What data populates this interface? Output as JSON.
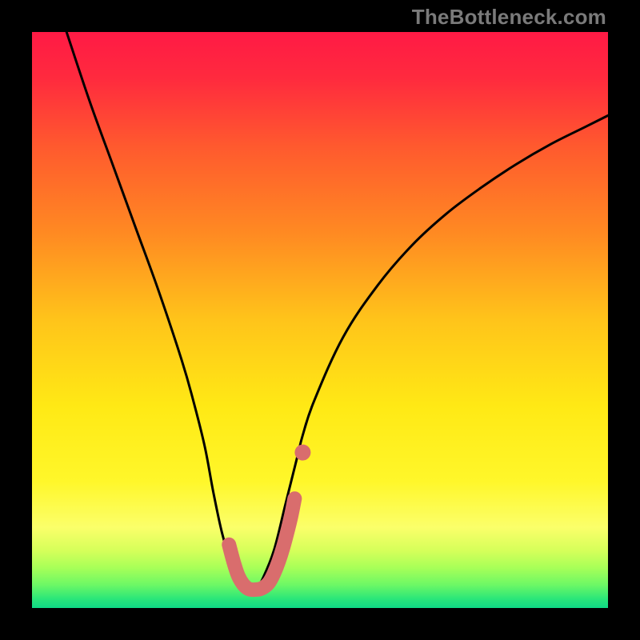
{
  "watermark": "TheBottleneck.com",
  "colors": {
    "frame": "#000000",
    "gradient_stops": [
      {
        "offset": 0.0,
        "color": "#ff1a45"
      },
      {
        "offset": 0.08,
        "color": "#ff2a3e"
      },
      {
        "offset": 0.2,
        "color": "#ff5a2e"
      },
      {
        "offset": 0.35,
        "color": "#ff8a22"
      },
      {
        "offset": 0.5,
        "color": "#ffc41a"
      },
      {
        "offset": 0.65,
        "color": "#ffe915"
      },
      {
        "offset": 0.78,
        "color": "#fff72a"
      },
      {
        "offset": 0.86,
        "color": "#fbff6a"
      },
      {
        "offset": 0.9,
        "color": "#d6ff5a"
      },
      {
        "offset": 0.93,
        "color": "#a8ff58"
      },
      {
        "offset": 0.96,
        "color": "#6cf865"
      },
      {
        "offset": 0.985,
        "color": "#28e57a"
      },
      {
        "offset": 1.0,
        "color": "#0fd985"
      }
    ],
    "curve_stroke": "#000000",
    "basin_stroke": "#d96d6d",
    "basin_dot": "#d96d6d"
  },
  "chart_data": {
    "type": "line",
    "title": "",
    "xlabel": "",
    "ylabel": "",
    "xlim": [
      0,
      100
    ],
    "ylim": [
      0,
      100
    ],
    "series": [
      {
        "name": "bottleneck-curve",
        "x": [
          6,
          10,
          14,
          18,
          22,
          26,
          28,
          30,
          31.5,
          33,
          34.5,
          36,
          37,
          37.6,
          38.2,
          39,
          40,
          42,
          44,
          46,
          47,
          49,
          54,
          60,
          66,
          72,
          78,
          84,
          90,
          96,
          100
        ],
        "y": [
          100,
          88,
          77,
          66,
          55,
          43,
          36,
          28,
          20,
          13,
          8,
          4.5,
          3.5,
          3.2,
          3.2,
          3.5,
          5,
          10,
          18,
          26,
          30,
          36,
          47,
          56,
          63,
          68.5,
          73,
          77,
          80.5,
          83.5,
          85.5
        ]
      }
    ],
    "basin": {
      "path_x": [
        34.2,
        35.0,
        35.8,
        36.6,
        37.3,
        38.0,
        38.8,
        39.6,
        40.4,
        41.2,
        42.0,
        42.8,
        43.6,
        44.4,
        45.0,
        45.6
      ],
      "path_y": [
        11.0,
        8.0,
        5.6,
        4.2,
        3.5,
        3.2,
        3.2,
        3.3,
        3.7,
        4.5,
        6.0,
        8.0,
        10.5,
        13.5,
        16.0,
        19.0
      ],
      "dot": {
        "x": 47.0,
        "y": 27.0
      }
    }
  }
}
